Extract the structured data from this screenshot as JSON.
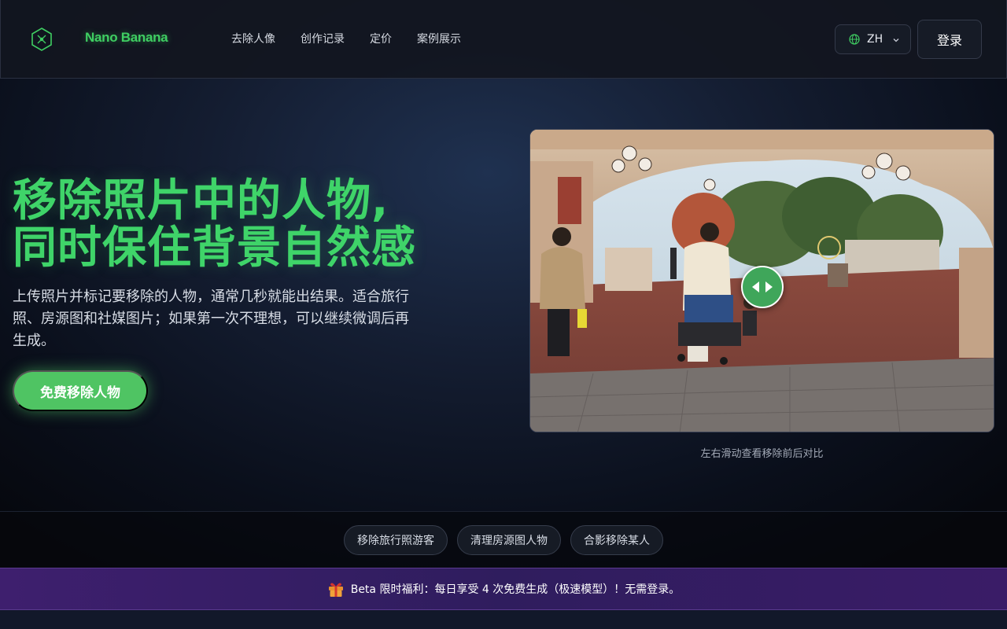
{
  "header": {
    "brand": "Nano Banana",
    "nav": [
      {
        "label": "去除人像"
      },
      {
        "label": "创作记录"
      },
      {
        "label": "定价"
      },
      {
        "label": "案例展示"
      }
    ],
    "language": "ZH",
    "login_label": "登录"
  },
  "hero": {
    "title_line1": "移除照片中的人物,",
    "title_line2": "同时保住背景自然感",
    "description": "上传照片并标记要移除的人物，通常几秒就能出结果。适合旅行照、房源图和社媒图片；如果第一次不理想，可以继续微调后再生成。",
    "cta_label": "免费移除人物"
  },
  "compare": {
    "caption": "左右滑动查看移除前后对比"
  },
  "chips": [
    {
      "label": "移除旅行照游客"
    },
    {
      "label": "清理房源图人物"
    },
    {
      "label": "合影移除某人"
    }
  ],
  "banner": {
    "text": "Beta 限时福利：每日享受 4 次免费生成（极速模型）！无需登录。"
  },
  "colors": {
    "accent_green": "#3fd469",
    "banner_purple": "#3e1f6e"
  },
  "icons": {
    "logo": "hexagon-logo-icon",
    "language": "globe-icon",
    "dropdown": "chevron-down-icon",
    "compare_handle": "left-right-arrows-icon",
    "banner": "gift-icon"
  }
}
